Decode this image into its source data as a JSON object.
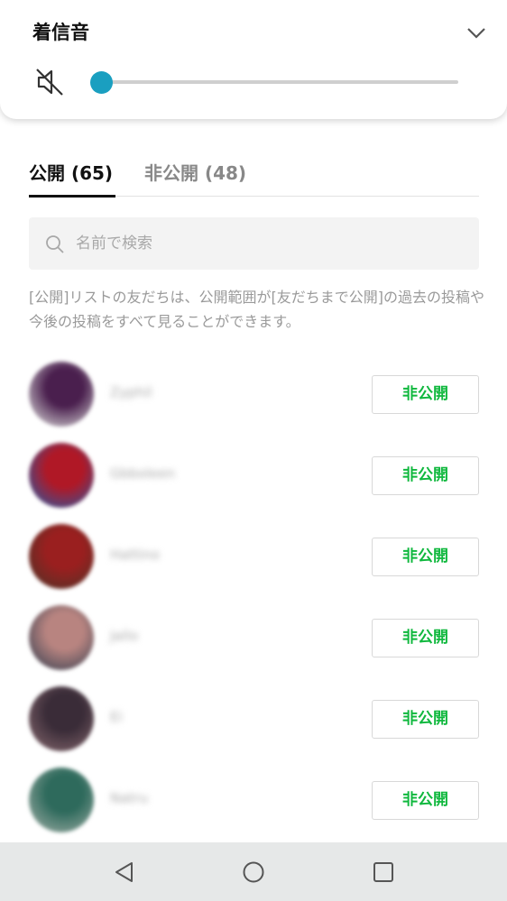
{
  "volume": {
    "title": "着信音",
    "level": 0.0,
    "accent_color": "#1a9fc0",
    "mute_icon": "speaker-muted-icon",
    "collapse_icon": "chevron-down-icon"
  },
  "tabs": [
    {
      "label": "公開 (65)",
      "active": true
    },
    {
      "label": "非公開 (48)",
      "active": false
    }
  ],
  "search": {
    "placeholder": "名前で検索",
    "value": ""
  },
  "description": "[公開]リストの友だちは、公開範囲が[友だちまで公開]の過去の投稿や今後の投稿をすべて見ることができます。",
  "friends": [
    {
      "name": "Zyphil",
      "button": "非公開",
      "avatar_colors": [
        "#4a1f4e",
        "#c8c2c8"
      ]
    },
    {
      "name": "Gbboleen",
      "button": "非公開",
      "avatar_colors": [
        "#b01826",
        "#3c4f90"
      ]
    },
    {
      "name": "Hattino",
      "button": "非公開",
      "avatar_colors": [
        "#9a1f1f",
        "#5a3026"
      ]
    },
    {
      "name": "Jallo",
      "button": "非公開",
      "avatar_colors": [
        "#b88480",
        "#4a4a58"
      ]
    },
    {
      "name": "Ei",
      "button": "非公開",
      "avatar_colors": [
        "#3a2c38",
        "#7a5f66"
      ]
    },
    {
      "name": "Natru",
      "button": "非公開",
      "avatar_colors": [
        "#2e6a5c",
        "#8ea39a"
      ]
    }
  ],
  "navbar": {
    "back": "back-icon",
    "home": "home-icon",
    "recents": "recents-icon"
  },
  "colors": {
    "button_text": "#10b83e",
    "navbar_bg": "#e6e8e8"
  }
}
